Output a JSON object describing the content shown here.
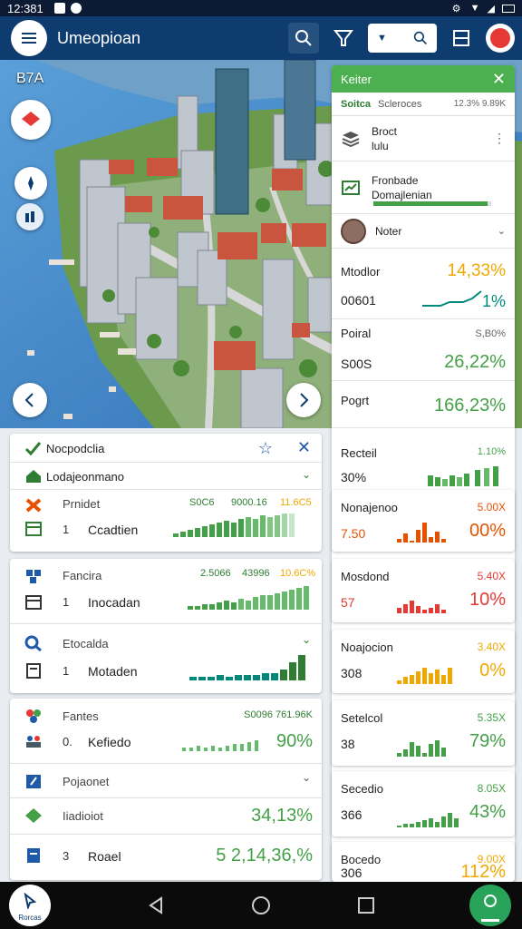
{
  "status": {
    "time": "12:381"
  },
  "app": {
    "title": "Umeopioan"
  },
  "map": {
    "label": "B7A"
  },
  "panel": {
    "header": "Keiter",
    "sub_green": "Soitca",
    "sub_label": "Scleroces",
    "sub_right": "12.3% 9.89K",
    "item1_a": "Broct",
    "item1_b": "lulu",
    "item2_a": "Fronbade",
    "item2_b": "Domajlenian",
    "item2_progress": 0.97,
    "user_name": "Noter",
    "stats": [
      {
        "title": "Mtodlor",
        "pct": "14,33%",
        "val": "00601",
        "big": "1%"
      },
      {
        "title": "Poiral",
        "small": "S,B0%",
        "val": "S00S",
        "big": "26,22%"
      },
      {
        "title": "Pogrt",
        "big": "166,23%"
      },
      {
        "title": "Recteil",
        "small": "1.10%",
        "val": "30%"
      }
    ]
  },
  "colors": {
    "appbar": "#0e3c6e",
    "accent": "#4caf50",
    "orange": "#f0a800",
    "red": "#e53935"
  },
  "card1": {
    "title": "Nocpodclia",
    "sub": "Lodajeonmano",
    "row_a": "Prnidet",
    "row_a_m1": "S0C6",
    "row_a_m2": "9000.16",
    "row_a_m3": "11.6C5",
    "row_b_num": "1",
    "row_b": "Ccadtien"
  },
  "card2": {
    "row_a": "Fancira",
    "row_a_m1": "2.5066",
    "row_a_m2": "43996",
    "row_a_m3": "10.6C%",
    "row_b_num": "1",
    "row_b": "Inocadan",
    "row_c": "Etocalda",
    "row_d_num": "1",
    "row_d": "Motaden"
  },
  "card3": {
    "row_a": "Fantes",
    "row_a_m": "S0096 761.96K",
    "row_b_num": "0.",
    "row_b": "Kefiedo",
    "row_b_big": "90%",
    "row_c": "Pojaonet",
    "row_d": "Iiadioiot",
    "row_d_big": "34,13%",
    "row_e_num": "3",
    "row_e": "Roael",
    "row_e_big": "5 2,14,36,%"
  },
  "rcards": [
    {
      "title": "Nonajenoo",
      "small": "5.00X",
      "val": "7.50",
      "big": "00%",
      "color": "#e65100"
    },
    {
      "title": "Mosdond",
      "small": "5.40X",
      "val": "57",
      "big": "10%",
      "color": "#e53935"
    },
    {
      "title": "Noajocion",
      "small": "3.40X",
      "val": "308",
      "big": "0%",
      "color": "#f0a800"
    },
    {
      "title": "Setelcol",
      "small": "5.35X",
      "val": "38",
      "big": "79%",
      "color": "#43a047"
    },
    {
      "title": "Secedio",
      "small": "8.05X",
      "val": "366",
      "big": "43%",
      "color": "#43a047"
    },
    {
      "title": "Bocedo",
      "small": "9.00X",
      "val": "306",
      "big": "112%",
      "color": "#f0a800"
    }
  ],
  "nav": {
    "left_label": "Rorcas"
  }
}
